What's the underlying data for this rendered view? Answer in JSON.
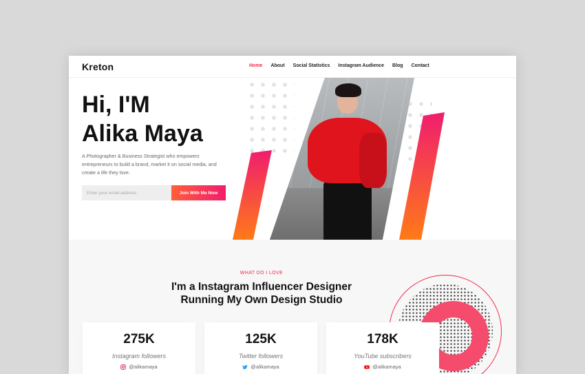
{
  "brand": {
    "name": "Kreton"
  },
  "nav": [
    {
      "label": "Home",
      "active": true
    },
    {
      "label": "About"
    },
    {
      "label": "Social Statistics"
    },
    {
      "label": "Instagram Audience"
    },
    {
      "label": "Blog"
    },
    {
      "label": "Contact"
    }
  ],
  "hero": {
    "title_line1": "Hi, I'M",
    "title_line2": "Alika Maya",
    "description": "A Photographer & Business Strategist who empowers entrepreneurs to build a brand, market it on social media, and create a life they love.",
    "email_placeholder": "Enter your email address",
    "cta_label": "Join With Me Now"
  },
  "section": {
    "eyebrow": "WHAT DO I LOVE",
    "headline_line1": "I'm a Instagram Influencer Designer",
    "headline_line2": "Running My Own Design Studio"
  },
  "stats": [
    {
      "value": "275K",
      "label": "Instagram followers",
      "handle": "@alikamaya",
      "icon": "instagram-icon"
    },
    {
      "value": "125K",
      "label": "Twitter followers",
      "handle": "@alikamaya",
      "icon": "twitter-icon"
    },
    {
      "value": "178K",
      "label": "YouTube subscribers",
      "handle": "@alikamaya",
      "icon": "youtube-icon"
    }
  ],
  "colors": {
    "accent": "#f0294c",
    "gradient_start": "#ff5e3a",
    "gradient_end": "#f01d6e"
  }
}
